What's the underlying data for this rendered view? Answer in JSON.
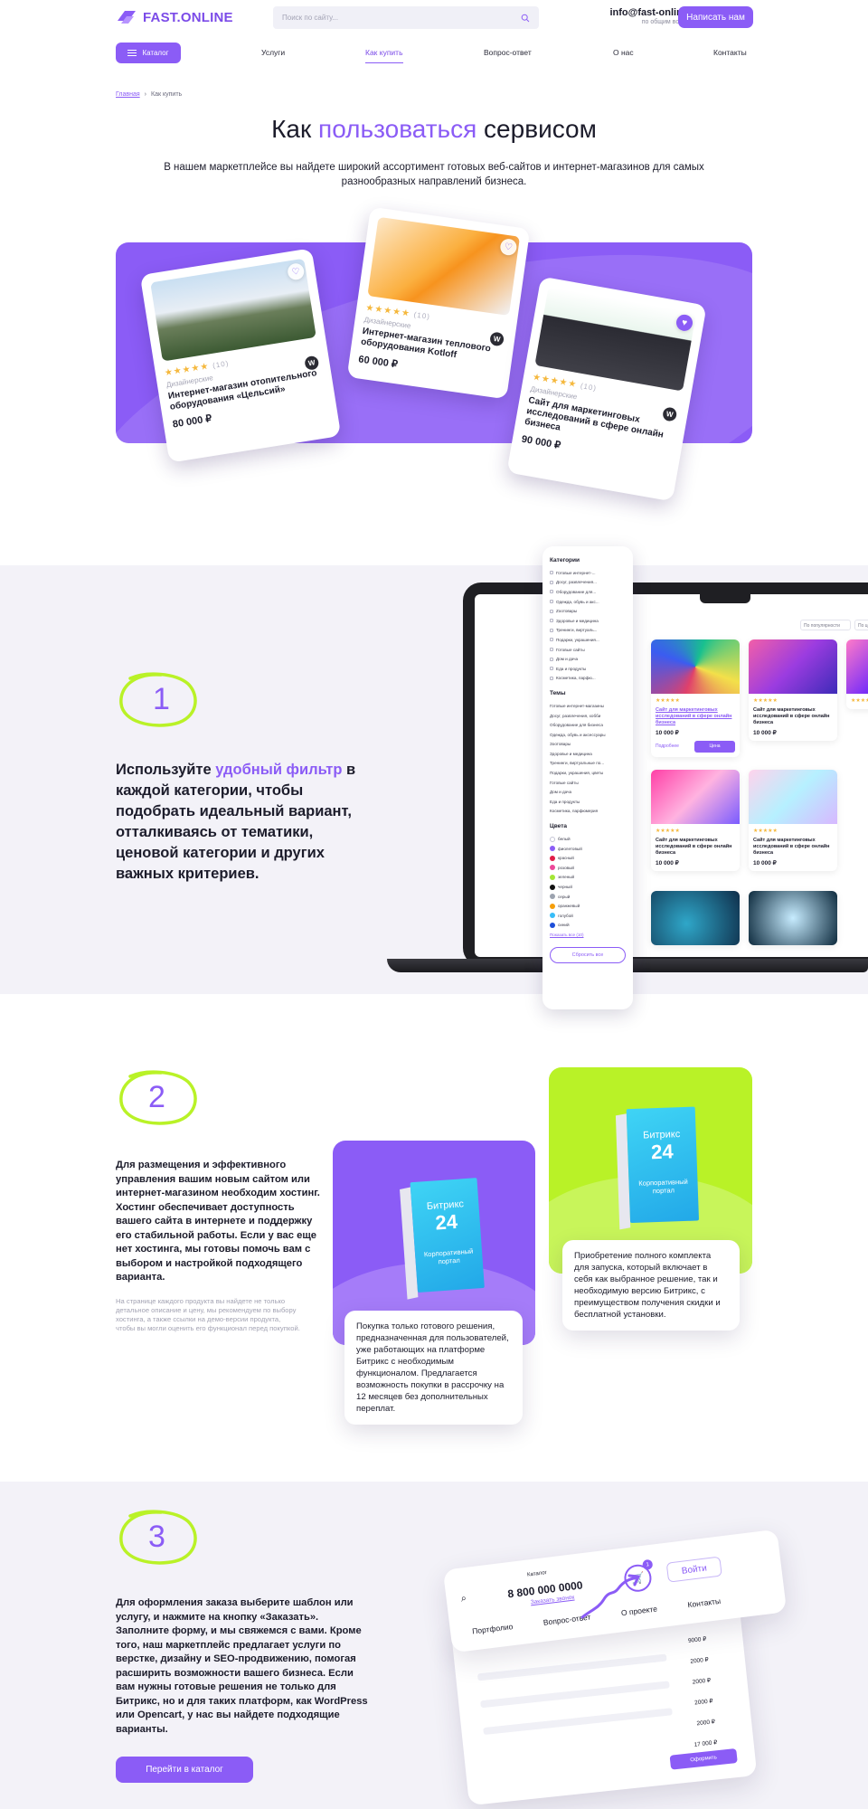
{
  "header": {
    "logo_text": "FAST.ONLINE",
    "search_placeholder": "Поиск по сайту...",
    "email": "info@fast-online.ru",
    "email_sub": "по общим вопросам",
    "write_button": "Написать нам"
  },
  "nav": {
    "catalog": "Каталог",
    "items": [
      "Услуги",
      "Как купить",
      "Вопрос-ответ",
      "О нас",
      "Контакты"
    ]
  },
  "breadcrumbs": {
    "home": "Главная",
    "current": "Как купить"
  },
  "hero": {
    "title_part1": "Как ",
    "title_accent": "пользоваться",
    "title_part2": " сервисом",
    "subtitle": "В нашем маркетплейсе вы найдете широкий ассортимент готовых веб-сайтов и интернет-магазинов для самых разнообразных направлений бизнеса."
  },
  "banner_cards": [
    {
      "category": "Дизайнерские",
      "reviews": "(10)",
      "title": "Интернет-магазин отопительного оборудования «Цельсий»",
      "price": "80 000 ₽"
    },
    {
      "category": "Дизайнерские",
      "reviews": "(10)",
      "title": "Интернет-магазин теплового оборудования Kotloff",
      "price": "60 000 ₽"
    },
    {
      "category": "Дизайнерские",
      "reviews": "(10)",
      "title": "Сайт для маркетинговых исследований в сфере онлайн бизнеса",
      "price": "90 000 ₽"
    }
  ],
  "step1": {
    "number": "1",
    "text_before": "Используйте ",
    "text_accent": "удобный фильтр",
    "text_after": " в каждой категории, чтобы подобрать идеальный вариант, отталкиваясь от тематики, ценовой категории и других важных критериев."
  },
  "filter": {
    "categories_title": "Категории",
    "categories": [
      "Готовые интернет-...",
      "Досуг, развлечения...",
      "Оборудование для...",
      "Одежда, обувь и акс...",
      "Zоотовары",
      "Здоровье и медицина",
      "Тренинги, виртуаль...",
      "Подарки, украшения...",
      "Готовые сайты",
      "Дом и дача",
      "Еда и продукты",
      "Косметика, парфю..."
    ],
    "themes_title": "Темы",
    "themes": [
      "Готовые интернет-магазины",
      "Досуг, развлечения, хобби",
      "Оборудование для бизнеса",
      "Одежда, обувь и аксессуары",
      "Зоотовары",
      "Здоровье и медицина",
      "Тренинги, виртуальные по...",
      "Подарки, украшения, цветы",
      "Готовые сайты",
      "Дом и дача",
      "Еда и продукты",
      "Косметика, парфюмерия"
    ],
    "colors_title": "Цвета",
    "colors": [
      {
        "name": "белый",
        "hex": "#ffffff"
      },
      {
        "name": "фиолетовый",
        "hex": "#8b5cf6"
      },
      {
        "name": "красный",
        "hex": "#e11d48"
      },
      {
        "name": "розовый",
        "hex": "#ec4899"
      },
      {
        "name": "зеленый",
        "hex": "#a3e635"
      },
      {
        "name": "черный",
        "hex": "#111111"
      },
      {
        "name": "серый",
        "hex": "#9ca3af"
      },
      {
        "name": "оранжевый",
        "hex": "#f59e0b"
      },
      {
        "name": "голубой",
        "hex": "#38bdf8"
      },
      {
        "name": "синий",
        "hex": "#1d4ed8"
      }
    ],
    "show_all": "Показать все (10)",
    "reset": "Сбросить все"
  },
  "laptop_cards": [
    {
      "title": "Сайт для маркетинговых исследований в сфере онлайн бизнеса",
      "price": "10 000 ₽",
      "more": "Подробнее",
      "buy": "Цена"
    },
    {
      "title": "Сайт для маркетинговых исследований в сфере онлайн бизнеса",
      "price": "10 000 ₽"
    },
    {
      "title": "Сайт для маркетинговых исследований в сфере онлайн бизнеса",
      "price": "10 000 ₽"
    },
    {
      "title": "Сайт для маркетинговых исследований в сфере онлайн бизнеса",
      "price": "10 000 ₽"
    }
  ],
  "laptop_sort": [
    "По популярности",
    "По цене"
  ],
  "step2": {
    "number": "2",
    "text": "Для размещения и эффективного управления вашим новым сайтом или интернет-магазином необходим хостинг. Хостинг обеспечивает доступность вашего сайта в интернете и поддержку его стабильной работы. Если у вас еще нет хостинга, мы готовы помочь вам с выбором и настройкой подходящего варианта.",
    "note": "На странице каждого продукта вы найдете не только детальное описание и цену, мы рекомендуем по выбору хостинга, а также ссылки на демо-версии продукта, чтобы вы могли оценить его функционал перед покупкой.",
    "card1_caption": "Покупка только готового решения, предназначенная для пользователей, уже работающих на платформе Битрикс с необходимым функционалом. Предлагается возможность покупки в рассрочку на 12 месяцев без дополнительных переплат.",
    "card2_caption": "Приобретение полного комплекта для запуска, который включает в себя как выбранное решение, так и необходимую версию Битрикс, с преимуществом получения скидки и бесплатной установки.",
    "box_brand": "Битрикс",
    "box_num": "24",
    "box_label": "Корпоративный портал"
  },
  "step3": {
    "number": "3",
    "text": "Для оформления заказа выберите шаблон или услугу, и нажмите на кнопку «Заказать». Заполните форму, и мы свяжемся с вами. Кроме того, наш маркетплейс предлагает услуги по верстке, дизайну и SEO-продвижению, помогая расширить возможности вашего бизнеса. Если вам нужны готовые решения не только для Битрикс, но и для таких платформ, как WordPress или Opencart, у нас вы найдете подходящие варианты.",
    "cta": "Перейти в каталог",
    "mock": {
      "catalog": "Каталог",
      "phone": "8 800 000 0000",
      "callback": "Заказать звонок",
      "login": "Войти",
      "tabs": [
        "Портфолио",
        "Вопрос-ответ",
        "О проекте",
        "Контакты"
      ],
      "prices": [
        "9000 ₽",
        "2000 ₽",
        "2000 ₽",
        "2000 ₽",
        "2000 ₽",
        "17 000 ₽"
      ],
      "order": "Оформить",
      "cart_count": "1"
    }
  },
  "colors": {
    "accent": "#8b5cf6",
    "lime": "#b9f227",
    "band": "#f3f2f8"
  }
}
